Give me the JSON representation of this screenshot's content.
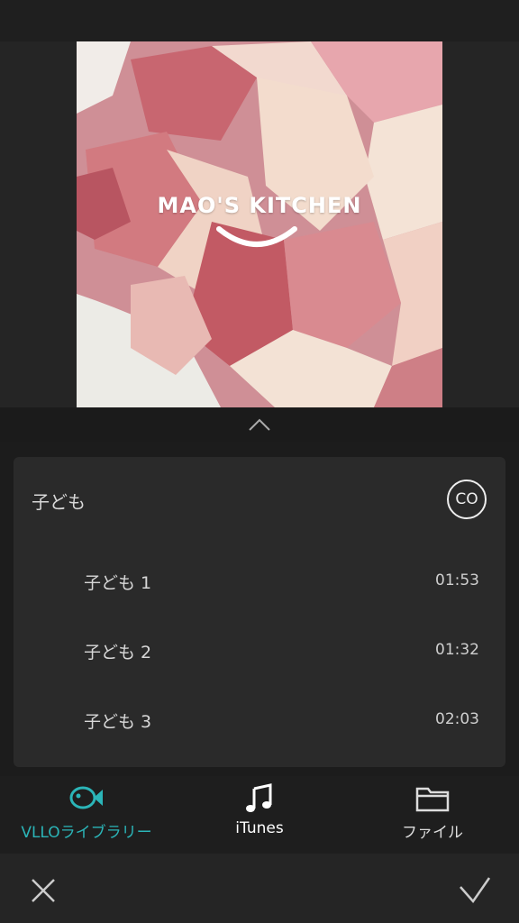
{
  "preview": {
    "logo_text": "MAO'S KITCHEN"
  },
  "library": {
    "category_title": "子ども",
    "badge": "CO",
    "tracks": [
      {
        "name": "子ども 1",
        "duration": "01:53"
      },
      {
        "name": "子ども 2",
        "duration": "01:32"
      },
      {
        "name": "子ども 3",
        "duration": "02:03"
      }
    ]
  },
  "tabs": [
    {
      "label": "VLLOライブラリー",
      "icon": "fish-icon",
      "active": true
    },
    {
      "label": "iTunes",
      "icon": "music-note-icon",
      "active": false
    },
    {
      "label": "ファイル",
      "icon": "folder-icon",
      "active": false
    }
  ],
  "colors": {
    "accent": "#2bb5b8",
    "background": "#1c1c1c",
    "card": "#2a2a2a"
  }
}
